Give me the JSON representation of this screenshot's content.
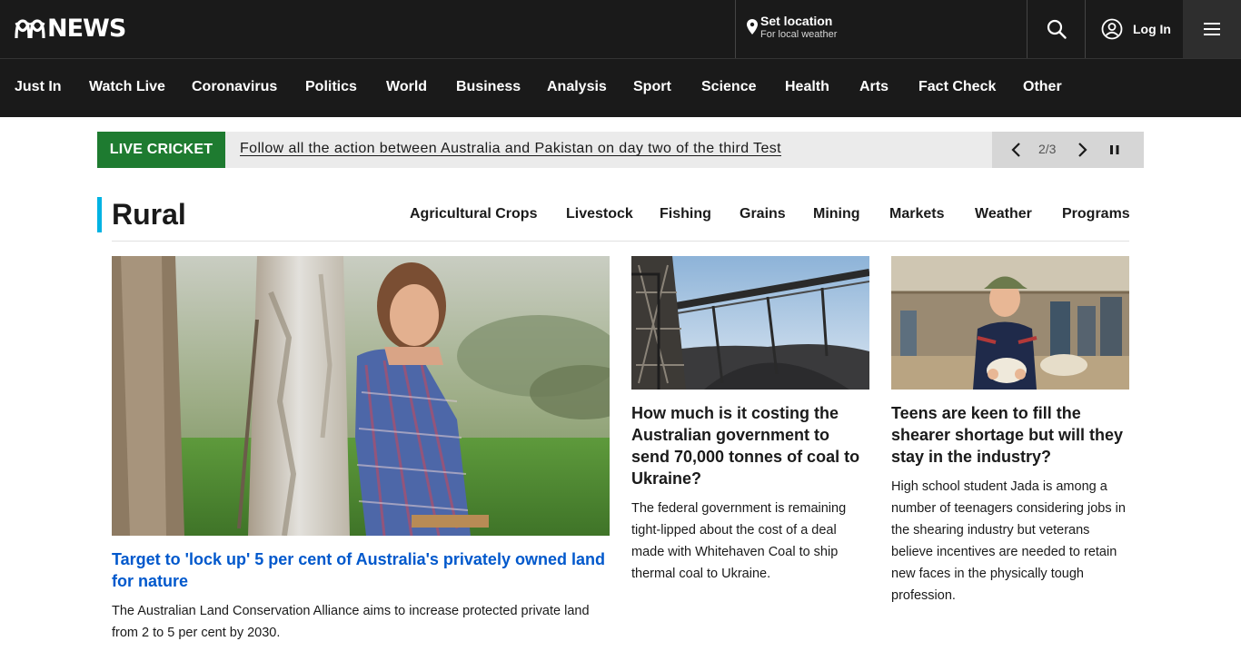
{
  "header": {
    "logo_text": "NEWS",
    "location_title": "Set location",
    "location_subtitle": "For local weather",
    "login_label": "Log In"
  },
  "nav": {
    "items": [
      "Just In",
      "Watch Live",
      "Coronavirus",
      "Politics",
      "World",
      "Business",
      "Analysis",
      "Sport",
      "Science",
      "Health",
      "Arts",
      "Fact Check",
      "Other"
    ]
  },
  "ticker": {
    "label": "LIVE CRICKET",
    "text": "Follow all the action between Australia and Pakistan on day two of the third Test",
    "counter": "2/3"
  },
  "section": {
    "title": "Rural",
    "subnav": [
      "Agricultural Crops",
      "Livestock",
      "Fishing",
      "Grains",
      "Mining",
      "Markets",
      "Weather",
      "Programs"
    ]
  },
  "stories": [
    {
      "headline": "Target to 'lock up' 5 per cent of Australia's privately owned land for nature",
      "summary": "The Australian Land Conservation Alliance aims to increase protected private land from 2 to 5 per cent by 2030."
    },
    {
      "headline": "How much is it costing the Australian government to send 70,000 tonnes of coal to Ukraine?",
      "summary": "The federal government is remaining tight-lipped about the cost of a deal made with Whitehaven Coal to ship thermal coal to Ukraine."
    },
    {
      "headline": "Teens are keen to fill the shearer shortage but will they stay in the industry?",
      "summary": "High school student Jada is among a number of teenagers considering jobs in the shearing industry but veterans believe incentives are needed to retain new faces in the physically tough profession."
    }
  ],
  "colors": {
    "header_bg": "#1a1a1a",
    "ticker_label_bg": "#1e7b30",
    "section_accent": "#00b3e3",
    "lead_headline": "#0058cc"
  },
  "icons": [
    "abc-logo-icon",
    "location-pin-icon",
    "search-icon",
    "user-icon",
    "hamburger-menu-icon",
    "chevron-left-icon",
    "chevron-right-icon",
    "pause-icon"
  ]
}
